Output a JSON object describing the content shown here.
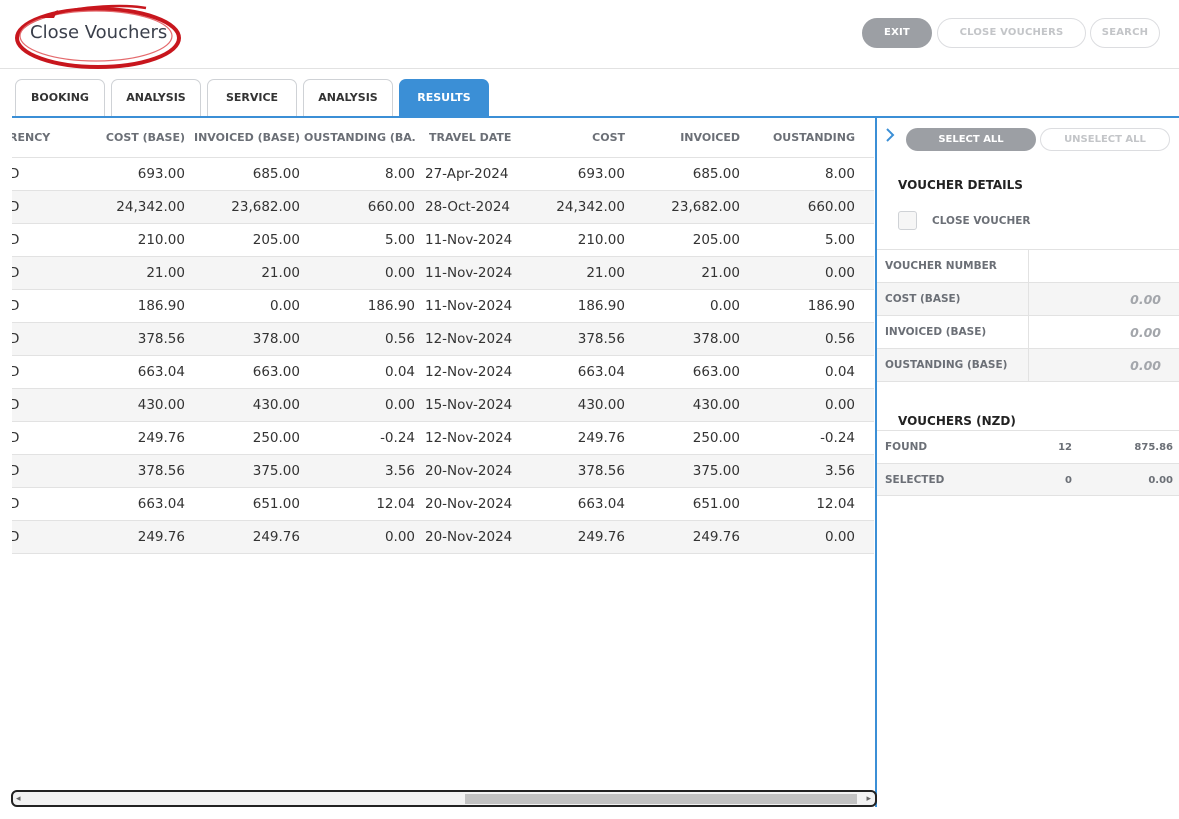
{
  "app": {
    "title": "Close Vouchers"
  },
  "header": {
    "exit_label": "EXIT",
    "close_vouchers_label": "CLOSE VOUCHERS",
    "search_label": "SEARCH"
  },
  "tabs": [
    {
      "label": "BOOKING",
      "active": false
    },
    {
      "label": "ANALYSIS",
      "active": false
    },
    {
      "label": "SERVICE",
      "active": false
    },
    {
      "label": "ANALYSIS",
      "active": false
    },
    {
      "label": "RESULTS",
      "active": true
    }
  ],
  "table": {
    "columns": [
      "RENCY",
      "COST (BASE)",
      "INVOICED (BASE)",
      "OUSTANDING (BA…",
      "TRAVEL DATE",
      "COST",
      "INVOICED",
      "OUSTANDING"
    ],
    "rows": [
      [
        "D",
        "693.00",
        "685.00",
        "8.00",
        "27-Apr-2024",
        "693.00",
        "685.00",
        "8.00"
      ],
      [
        "D",
        "24,342.00",
        "23,682.00",
        "660.00",
        "28-Oct-2024",
        "24,342.00",
        "23,682.00",
        "660.00"
      ],
      [
        "D",
        "210.00",
        "205.00",
        "5.00",
        "11-Nov-2024",
        "210.00",
        "205.00",
        "5.00"
      ],
      [
        "D",
        "21.00",
        "21.00",
        "0.00",
        "11-Nov-2024",
        "21.00",
        "21.00",
        "0.00"
      ],
      [
        "D",
        "186.90",
        "0.00",
        "186.90",
        "11-Nov-2024",
        "186.90",
        "0.00",
        "186.90"
      ],
      [
        "D",
        "378.56",
        "378.00",
        "0.56",
        "12-Nov-2024",
        "378.56",
        "378.00",
        "0.56"
      ],
      [
        "D",
        "663.04",
        "663.00",
        "0.04",
        "12-Nov-2024",
        "663.04",
        "663.00",
        "0.04"
      ],
      [
        "D",
        "430.00",
        "430.00",
        "0.00",
        "15-Nov-2024",
        "430.00",
        "430.00",
        "0.00"
      ],
      [
        "D",
        "249.76",
        "250.00",
        "-0.24",
        "12-Nov-2024",
        "249.76",
        "250.00",
        "-0.24"
      ],
      [
        "D",
        "378.56",
        "375.00",
        "3.56",
        "20-Nov-2024",
        "378.56",
        "375.00",
        "3.56"
      ],
      [
        "D",
        "663.04",
        "651.00",
        "12.04",
        "20-Nov-2024",
        "663.04",
        "651.00",
        "12.04"
      ],
      [
        "D",
        "249.76",
        "249.76",
        "0.00",
        "20-Nov-2024",
        "249.76",
        "249.76",
        "0.00"
      ]
    ]
  },
  "panel": {
    "select_all_label": "SELECT ALL",
    "unselect_all_label": "UNSELECT ALL",
    "details_title": "VOUCHER DETAILS",
    "close_voucher_label": "CLOSE VOUCHER",
    "close_voucher_checked": false,
    "details": [
      {
        "label": "VOUCHER NUMBER",
        "value": ""
      },
      {
        "label": "COST (BASE)",
        "value": "0.00"
      },
      {
        "label": "INVOICED (BASE)",
        "value": "0.00"
      },
      {
        "label": "OUSTANDING (BASE)",
        "value": "0.00"
      }
    ],
    "vouchers_title": "VOUCHERS (NZD)",
    "vouchers": [
      {
        "label": "FOUND",
        "count": "12",
        "amount": "875.86"
      },
      {
        "label": "SELECTED",
        "count": "0",
        "amount": "0.00"
      }
    ]
  },
  "colors": {
    "accent": "#3b8fd6",
    "logo_ring": "#c8161d",
    "button_gray": "#9c9fa4"
  }
}
